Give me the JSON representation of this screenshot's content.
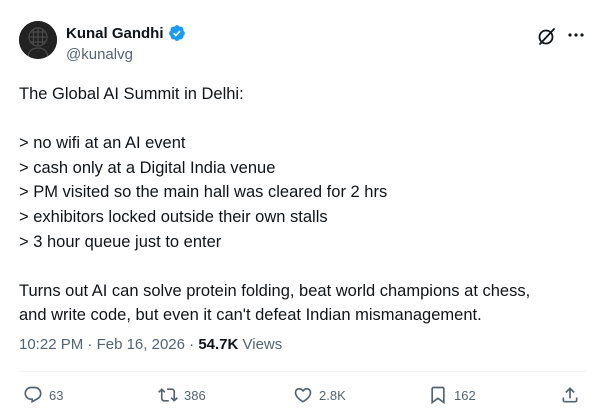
{
  "author": {
    "display_name": "Kunal Gandhi",
    "handle": "@kunalvg",
    "verified": true
  },
  "tweet": {
    "lines": [
      "The Global AI Summit in Delhi:",
      "",
      "> no wifi at an AI event",
      "> cash only at a Digital India venue",
      "> PM visited so the main hall was cleared for 2 hrs",
      "> exhibitors locked outside their own stalls",
      "> 3 hour queue just to enter",
      "",
      "Turns out AI can solve protein folding, beat world champions at chess,",
      "and write code, but even it can't defeat Indian mismanagement."
    ]
  },
  "meta": {
    "time": "10:22 PM",
    "separator": " · ",
    "date": "Feb 16, 2026",
    "views_count": "54.7K",
    "views_label": " Views"
  },
  "actions": {
    "replies": "63",
    "reposts": "386",
    "likes": "2.8K",
    "bookmarks": "162"
  },
  "colors": {
    "text_primary": "#0f1419",
    "text_secondary": "#536471",
    "verified_blue": "#1d9bf0",
    "divider": "#eff3f4"
  },
  "icons": [
    "verified-badge-icon",
    "grok-icon",
    "more-icon",
    "reply-icon",
    "repost-icon",
    "like-icon",
    "bookmark-icon",
    "share-icon"
  ]
}
